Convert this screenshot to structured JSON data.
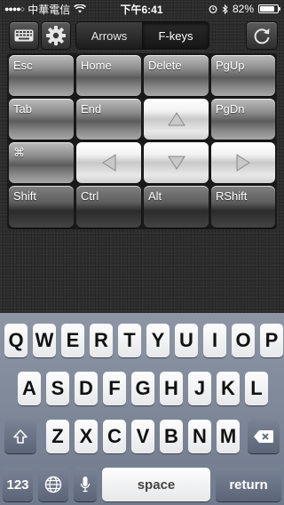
{
  "status_bar": {
    "carrier": "中華電信",
    "time": "下午6:41",
    "battery": "82%",
    "battery_level": 0.82
  },
  "toolbar": {
    "keyboard_icon": "keyboard-icon",
    "settings_icon": "gear-icon",
    "refresh_icon": "refresh-icon",
    "segments": [
      {
        "label": "Arrows",
        "selected": false
      },
      {
        "label": "F-keys",
        "selected": true
      }
    ]
  },
  "keys": {
    "esc": "Esc",
    "home": "Home",
    "delete": "Delete",
    "pgup": "PgUp",
    "tab": "Tab",
    "end": "End",
    "pgdn": "PgDn",
    "cmd": "⌘",
    "shift": "Shift",
    "ctrl": "Ctrl",
    "alt": "Alt",
    "rshift": "RShift",
    "arrows": [
      "up-arrow-icon",
      "left-arrow-icon",
      "down-arrow-icon",
      "right-arrow-icon"
    ]
  },
  "keyboard": {
    "row1": [
      "Q",
      "W",
      "E",
      "R",
      "T",
      "Y",
      "U",
      "I",
      "O",
      "P"
    ],
    "row2": [
      "A",
      "S",
      "D",
      "F",
      "G",
      "H",
      "J",
      "K",
      "L"
    ],
    "row3": [
      "Z",
      "X",
      "C",
      "V",
      "B",
      "N",
      "M"
    ],
    "numbers": "123",
    "space": "space",
    "return": "return"
  }
}
